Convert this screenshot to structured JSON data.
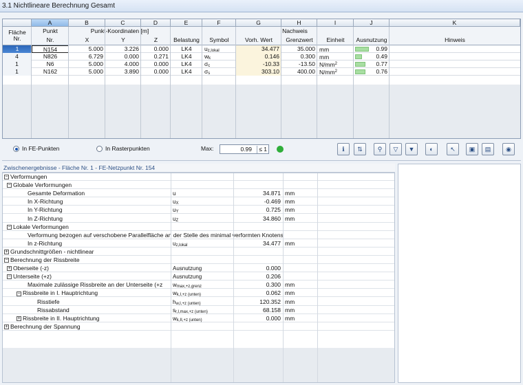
{
  "window": {
    "title": "3.1 Nichtlineare Berechnung Gesamt"
  },
  "table": {
    "col_letters": [
      "A",
      "B",
      "C",
      "D",
      "E",
      "F",
      "G",
      "H",
      "I",
      "J",
      "K"
    ],
    "headers": {
      "flaeche": "Fläche",
      "flaeche_nr": "Nr.",
      "punkt": "Punkt",
      "punkt_nr": "Nr.",
      "koordinaten_group": "Punkt-Koordinaten [m]",
      "x": "X",
      "y": "Y",
      "z": "Z",
      "belastung": "Belastung",
      "symbol": "Symbol",
      "nachweis_group": "Nachweis",
      "vorh_wert": "Vorh. Wert",
      "grenzwert": "Grenzwert",
      "einheit": "Einheit",
      "ausnutzung": "Ausnutzung",
      "hinweis": "Hinweis"
    },
    "rows": [
      {
        "flaeche": "1",
        "punkt": "N154",
        "x": "5.000",
        "y": "3.226",
        "z": "0.000",
        "belastung": "LK4",
        "symbol": "u",
        "symbol_sub": "z,lokal",
        "vorh": "34.477",
        "grenz": "35.000",
        "einheit": "mm",
        "einheit_sup": "",
        "ausnutzung": "0.99",
        "ausnutzung_fraction": 0.99
      },
      {
        "flaeche": "4",
        "punkt": "N826",
        "x": "6.729",
        "y": "0.000",
        "z": "0.271",
        "belastung": "LK4",
        "symbol": "w",
        "symbol_sub": "k",
        "vorh": "0.146",
        "grenz": "0.300",
        "einheit": "mm",
        "einheit_sup": "",
        "ausnutzung": "0.49",
        "ausnutzung_fraction": 0.49
      },
      {
        "flaeche": "1",
        "punkt": "N6",
        "x": "5.000",
        "y": "4.000",
        "z": "0.000",
        "belastung": "LK4",
        "symbol": "σ",
        "symbol_sub": "c",
        "vorh": "-10.33",
        "grenz": "-13.50",
        "einheit": "N/mm",
        "einheit_sup": "2",
        "ausnutzung": "0.77",
        "ausnutzung_fraction": 0.77
      },
      {
        "flaeche": "1",
        "punkt": "N162",
        "x": "5.000",
        "y": "3.890",
        "z": "0.000",
        "belastung": "LK4",
        "symbol": "σ",
        "symbol_sub": "s",
        "vorh": "303.10",
        "grenz": "400.00",
        "einheit": "N/mm",
        "einheit_sup": "2",
        "ausnutzung": "0.76",
        "ausnutzung_fraction": 0.76
      }
    ]
  },
  "toolbar": {
    "radio_fe": "In FE-Punkten",
    "radio_raster": "In Rasterpunkten",
    "max_label": "Max:",
    "max_value": "0.99",
    "max_limit": "≤ 1",
    "status_color": "#2fae3a",
    "buttons": [
      "info-icon",
      "sort-icon",
      "filter-icon",
      "funnel-icon",
      "filter-value-icon",
      "color-icon",
      "select-icon",
      "view-icon",
      "excel-icon",
      "eye-icon"
    ]
  },
  "lower": {
    "title": "Zwischenergebnisse  -  Fläche Nr. 1 - FE-Netzpunkt Nr. 154",
    "rows": [
      {
        "level": 0,
        "exp": "−",
        "label": "Verformungen",
        "sym": "",
        "sub": "",
        "val": "",
        "unit": ""
      },
      {
        "level": 1,
        "exp": "−",
        "label": "Globale Verformungen",
        "sym": "",
        "sub": "",
        "val": "",
        "unit": ""
      },
      {
        "level": 3,
        "exp": "",
        "label": "Gesamte Deformation",
        "sym": "u",
        "sub": "",
        "val": "34.871",
        "unit": "mm"
      },
      {
        "level": 3,
        "exp": "",
        "label": "In X-Richtung",
        "sym": "u",
        "sub": "X",
        "val": "-0.469",
        "unit": "mm"
      },
      {
        "level": 3,
        "exp": "",
        "label": "In Y-Richtung",
        "sym": "u",
        "sub": "Y",
        "val": "0.725",
        "unit": "mm"
      },
      {
        "level": 3,
        "exp": "",
        "label": "In Z-Richtung",
        "sym": "u",
        "sub": "Z",
        "val": "34.860",
        "unit": "mm"
      },
      {
        "level": 1,
        "exp": "−",
        "label": "Lokale Verformungen",
        "sym": "",
        "sub": "",
        "val": "",
        "unit": ""
      },
      {
        "level": 3,
        "exp": "",
        "label": "Verformung bezogen auf verschobene Parallelfläche an der Stelle des minimal verformten Knotens",
        "sym": "",
        "sub": "",
        "val": "",
        "unit": ""
      },
      {
        "level": 3,
        "exp": "",
        "label": "In z-Richtung",
        "sym": "u",
        "sub": "z,lokal",
        "val": "34.477",
        "unit": "mm"
      },
      {
        "level": 0,
        "exp": "+",
        "label": "Grundschnittgrößen - nichtlinear",
        "sym": "",
        "sub": "",
        "val": "",
        "unit": ""
      },
      {
        "level": 0,
        "exp": "−",
        "label": "Berechnung der Rissbreite",
        "sym": "",
        "sub": "",
        "val": "",
        "unit": ""
      },
      {
        "level": 1,
        "exp": "+",
        "label": "Oberseite (-z)",
        "sym": "Ausnutzung",
        "sub": "",
        "val": "0.000",
        "unit": ""
      },
      {
        "level": 1,
        "exp": "−",
        "label": "Unterseite (+z)",
        "sym": "Ausnutzung",
        "sub": "",
        "val": "0.206",
        "unit": ""
      },
      {
        "level": 3,
        "exp": "",
        "label": "Maximale zulässige Rissbreite an der Unterseite (+z",
        "sym": "w",
        "sub": "max,+z,grenz",
        "val": "0.300",
        "unit": "mm"
      },
      {
        "level": 2,
        "exp": "−",
        "label": "Rissbreite in I. Hauptrichtung",
        "sym": "w",
        "sub": "k,I,+z (unten)",
        "val": "0.062",
        "unit": "mm"
      },
      {
        "level": 4,
        "exp": "",
        "label": "Risstiefe",
        "sym": "h",
        "sub": "w,I,+z (unten)",
        "val": "120.352",
        "unit": "mm"
      },
      {
        "level": 4,
        "exp": "",
        "label": "Rissabstand",
        "sym": "s",
        "sub": "r,I,max,+z (unten)",
        "val": "68.158",
        "unit": "mm"
      },
      {
        "level": 2,
        "exp": "+",
        "label": "Rissbreite in II. Hauptrichtung",
        "sym": "w",
        "sub": "k,II,+z (unten)",
        "val": "0.000",
        "unit": "mm"
      },
      {
        "level": 0,
        "exp": "+",
        "label": "Berechnung der Spannung",
        "sym": "",
        "sub": "",
        "val": "",
        "unit": ""
      }
    ]
  }
}
